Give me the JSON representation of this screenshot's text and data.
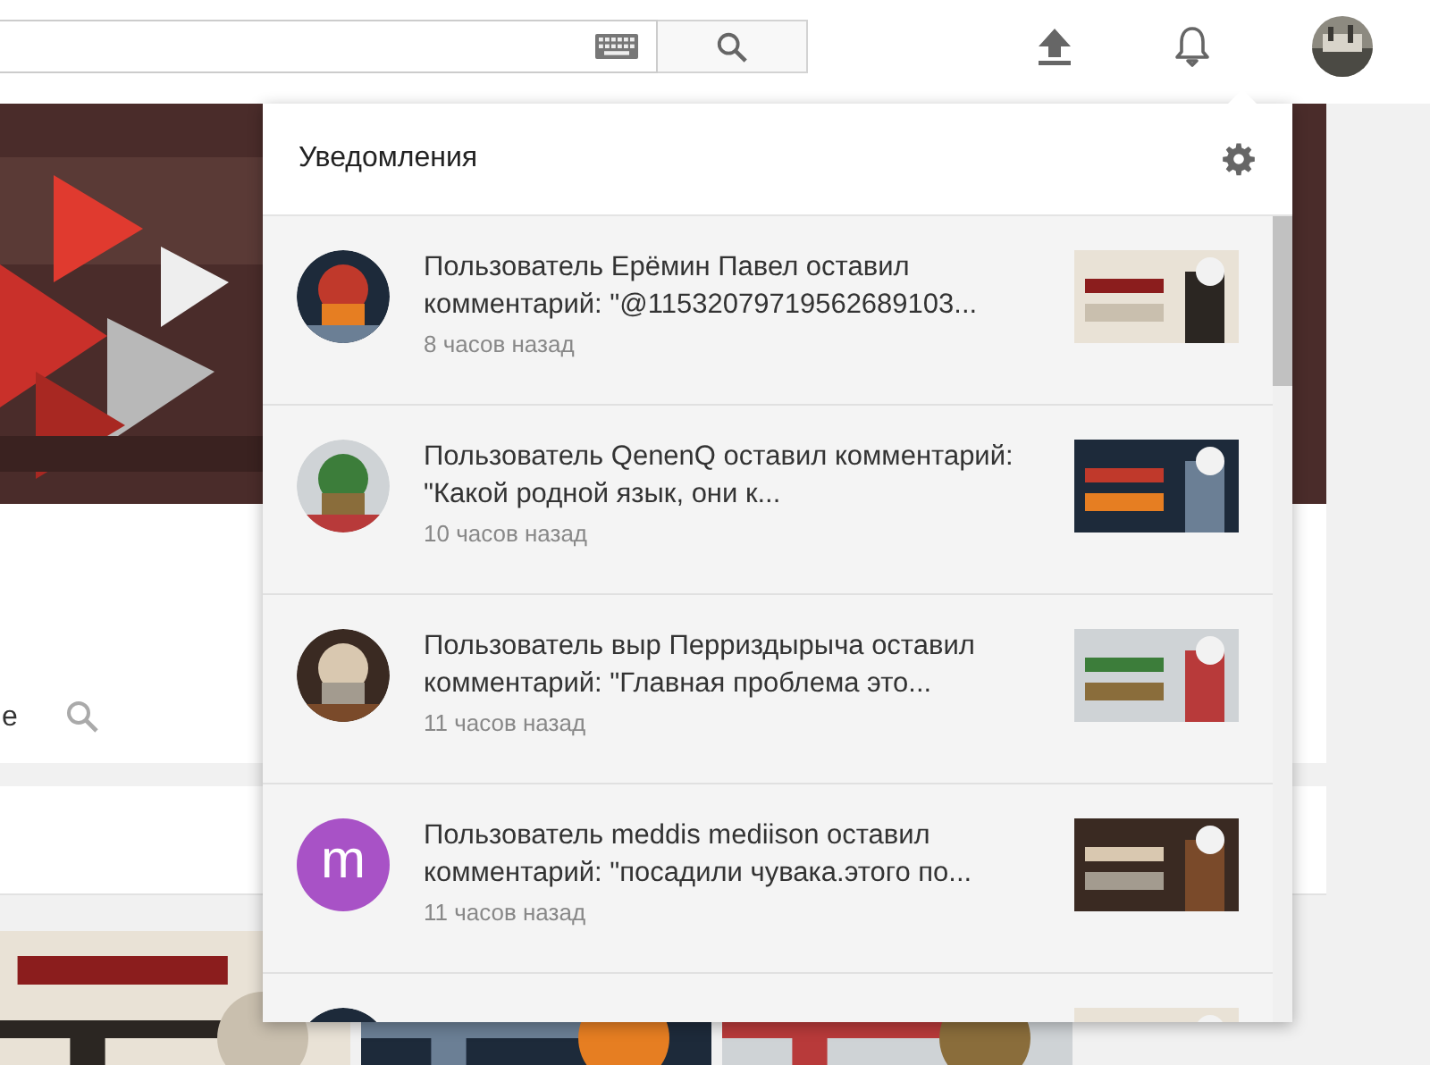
{
  "masthead": {
    "search": {
      "kind": "field"
    }
  },
  "channel": {
    "banner": {
      "kind": "picture"
    },
    "partial_text": "е"
  },
  "videos": [
    {
      "kind": "picture"
    },
    {
      "kind": "picture"
    },
    {
      "kind": "picture"
    }
  ],
  "notifications": {
    "title": "Уведомления",
    "items": [
      {
        "kind": "picture",
        "message": "Пользователь Ерёмин Павел оставил комментарий: \"@11532079719562689103...",
        "time": "8 часов назад"
      },
      {
        "kind": "picture",
        "message": "Пользователь QenenQ оставил комментарий: \"Какой родной язык, они к...",
        "time": "10 часов назад"
      },
      {
        "kind": "picture",
        "message": "Пользователь выр Перриздырыча оставил комментарий: \"Главная проблема это...",
        "time": "11 часов назад"
      },
      {
        "kind": "letter",
        "letter": "m",
        "color": "#a852c6",
        "message": "Пользователь meddis mediison оставил комментарий: \"посадили чувака.этого по...",
        "time": "11 часов назад"
      },
      {
        "kind": "picture"
      }
    ]
  }
}
